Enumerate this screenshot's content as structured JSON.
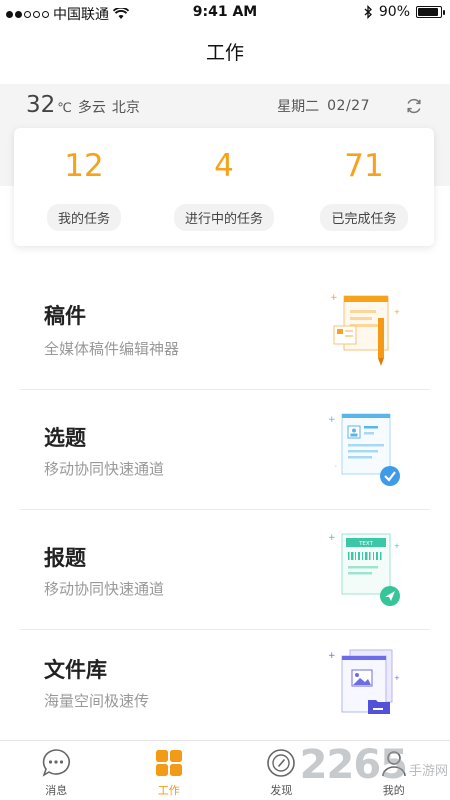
{
  "status_bar": {
    "carrier": "中国联通",
    "time": "9:41 AM",
    "battery": "90%",
    "battery_level": 0.9
  },
  "header": {
    "title": "工作"
  },
  "weather": {
    "temperature": "32",
    "unit": "℃",
    "condition": "多云",
    "city": "北京"
  },
  "date": {
    "weekday": "星期二",
    "date": "02/27"
  },
  "stats": [
    {
      "value": "12",
      "label": "我的任务"
    },
    {
      "value": "4",
      "label": "进行中的任务"
    },
    {
      "value": "71",
      "label": "已完成任务"
    }
  ],
  "menu": [
    {
      "title": "稿件",
      "subtitle": "全媒体稿件编辑神器",
      "icon": "manuscript-illustration"
    },
    {
      "title": "选题",
      "subtitle": "移动协同快速通道",
      "icon": "topic-illustration"
    },
    {
      "title": "报题",
      "subtitle": "移动协同快速通道",
      "icon": "report-illustration",
      "badge_text": "TEXT"
    },
    {
      "title": "文件库",
      "subtitle": "海量空间极速传",
      "icon": "file-library-illustration"
    }
  ],
  "tabs": [
    {
      "label": "消息",
      "icon": "message-icon"
    },
    {
      "label": "工作",
      "icon": "grid-icon",
      "active": true
    },
    {
      "label": "发现",
      "icon": "compass-icon"
    },
    {
      "label": "我的",
      "icon": "profile-icon"
    }
  ],
  "watermark": {
    "digits": "2265",
    "text": "手游网"
  },
  "colors": {
    "accent": "#f6a21a",
    "tab_active": "#f39a16",
    "band": "#f4f4f4"
  }
}
